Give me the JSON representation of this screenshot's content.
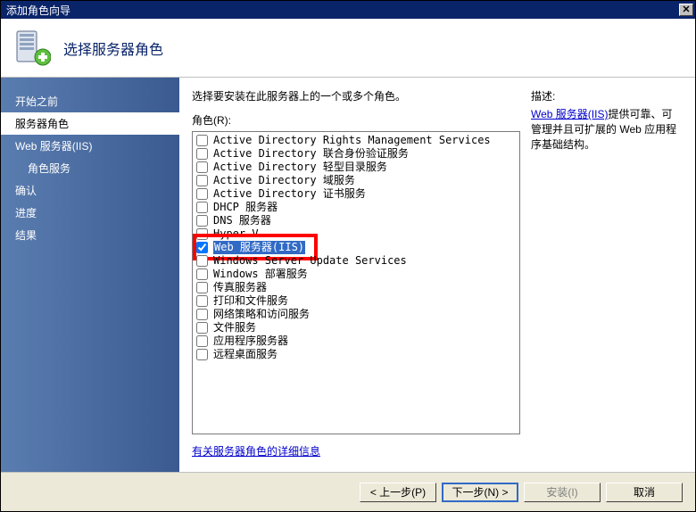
{
  "window": {
    "title": "添加角色向导"
  },
  "header": {
    "title": "选择服务器角色"
  },
  "sidebar": {
    "items": [
      {
        "label": "开始之前",
        "selected": false,
        "indent": false
      },
      {
        "label": "服务器角色",
        "selected": true,
        "indent": false
      },
      {
        "label": "Web 服务器(IIS)",
        "selected": false,
        "indent": false
      },
      {
        "label": "角色服务",
        "selected": false,
        "indent": true
      },
      {
        "label": "确认",
        "selected": false,
        "indent": false
      },
      {
        "label": "进度",
        "selected": false,
        "indent": false
      },
      {
        "label": "结果",
        "selected": false,
        "indent": false
      }
    ]
  },
  "main": {
    "instruction": "选择要安装在此服务器上的一个或多个角色。",
    "roles_label": "角色(R):",
    "roles": [
      {
        "label": "Active Directory Rights Management Services",
        "checked": false
      },
      {
        "label": "Active Directory 联合身份验证服务",
        "checked": false
      },
      {
        "label": "Active Directory 轻型目录服务",
        "checked": false
      },
      {
        "label": "Active Directory 域服务",
        "checked": false
      },
      {
        "label": "Active Directory 证书服务",
        "checked": false
      },
      {
        "label": "DHCP 服务器",
        "checked": false
      },
      {
        "label": "DNS 服务器",
        "checked": false
      },
      {
        "label": "Hyper-V",
        "checked": false
      },
      {
        "label": "Web 服务器(IIS)",
        "checked": true,
        "selected": true,
        "highlight": true
      },
      {
        "label": "Windows Server Update Services",
        "checked": false
      },
      {
        "label": "Windows 部署服务",
        "checked": false
      },
      {
        "label": "传真服务器",
        "checked": false
      },
      {
        "label": "打印和文件服务",
        "checked": false
      },
      {
        "label": "网络策略和访问服务",
        "checked": false
      },
      {
        "label": "文件服务",
        "checked": false
      },
      {
        "label": "应用程序服务器",
        "checked": false
      },
      {
        "label": "远程桌面服务",
        "checked": false
      }
    ],
    "more_link": "有关服务器角色的详细信息"
  },
  "right": {
    "desc_label": "描述:",
    "link_text": "Web 服务器(IIS)",
    "desc_rest": "提供可靠、可管理并且可扩展的 Web 应用程序基础结构。"
  },
  "footer": {
    "prev": "< 上一步(P)",
    "next": "下一步(N) >",
    "install": "安装(I)",
    "cancel": "取消"
  }
}
